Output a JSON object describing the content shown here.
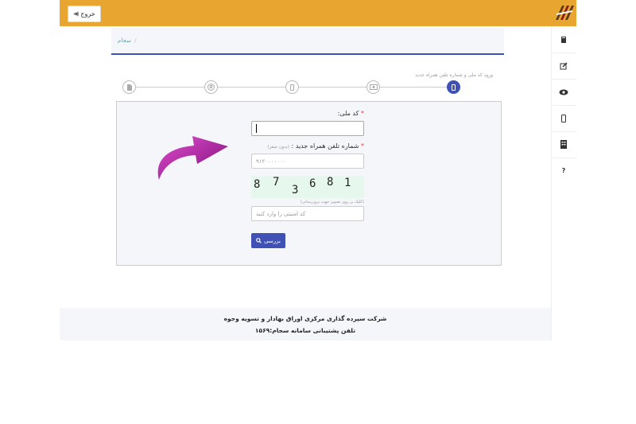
{
  "header": {
    "logout_label": "خروج",
    "accent_color": "#e8a630"
  },
  "sidebar": {
    "items": [
      {
        "icon": "book-icon"
      },
      {
        "icon": "edit-icon"
      },
      {
        "icon": "eye-icon"
      },
      {
        "icon": "mobile-icon"
      },
      {
        "icon": "building-icon"
      },
      {
        "icon": "question-icon",
        "label": "?"
      }
    ]
  },
  "breadcrumb": {
    "current": "سجام",
    "separator": "/"
  },
  "steps": {
    "label": "ورود کد ملی و شماره تلفن همراه جدید",
    "items": [
      {
        "icon": "file-icon",
        "active": false
      },
      {
        "icon": "registered-icon",
        "active": false
      },
      {
        "icon": "mobile-icon",
        "active": false
      },
      {
        "icon": "money-icon",
        "active": false
      },
      {
        "icon": "mobile-icon",
        "active": true
      }
    ],
    "active_color": "#3f51b5"
  },
  "form": {
    "national_code": {
      "label": "کد ملی:",
      "required_mark": "*",
      "value": ""
    },
    "mobile": {
      "label": "شماره تلفن همراه جدید :",
      "hint": "(بدون صفر)",
      "required_mark": "*",
      "placeholder": "۹۱۲۰۰۰۰۰۰۰"
    },
    "captcha": {
      "digits": [
        "8",
        "7",
        "3",
        "6",
        "8",
        "1"
      ],
      "hint": "(کلیک بر روی تصویر جهت بروزرسانی)"
    },
    "security_code": {
      "placeholder": "کد امنیتی را وارد کنید"
    },
    "submit_label": "بررسی"
  },
  "footer": {
    "line1": "شرکت سپرده گذاری مرکزی اوراق بهادار و تسویه وجوه",
    "line2": "تلفن پشتیبانی سامانه سجام:۱۵۶۹"
  }
}
